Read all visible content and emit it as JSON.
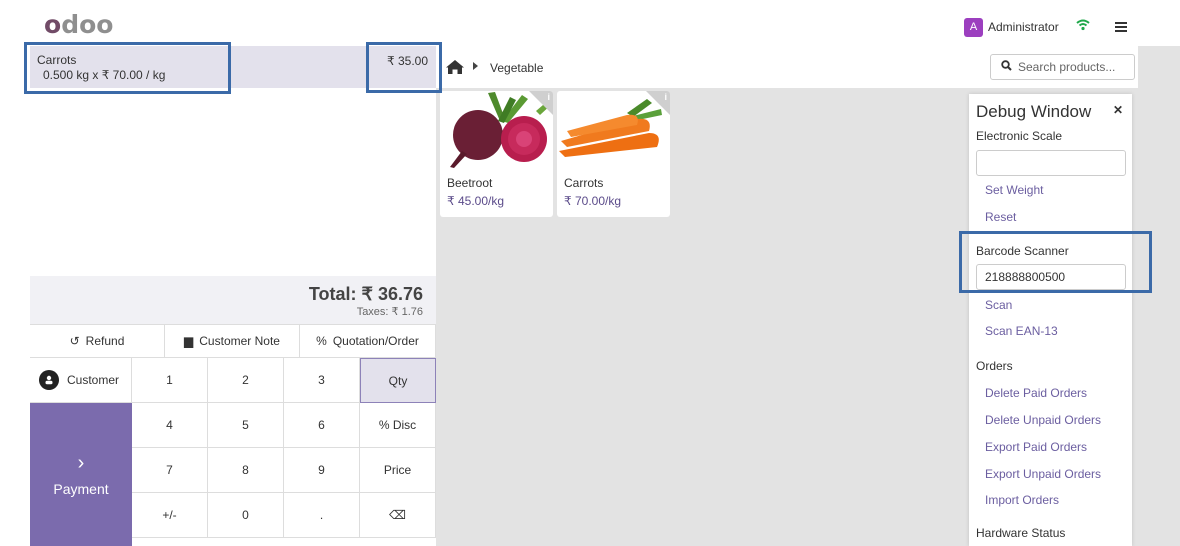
{
  "header": {
    "logo_o1": "o",
    "logo_d": "d",
    "logo_o2": "o",
    "logo_o3": "o",
    "user_initial": "A",
    "user_name": "Administrator"
  },
  "order": {
    "line": {
      "product": "Carrots",
      "detail": "0.500  kg x ₹ 70.00 / kg",
      "price": "₹ 35.00"
    },
    "total": "Total: ₹ 36.76",
    "taxes": "Taxes: ₹ 1.76"
  },
  "controls": {
    "refund": "Refund",
    "customer_note": "Customer Note",
    "quotation": "Quotation/Order"
  },
  "numpad": {
    "customer": "Customer",
    "payment": "Payment",
    "keys": [
      "1",
      "2",
      "3",
      "Qty",
      "4",
      "5",
      "6",
      "% Disc",
      "7",
      "8",
      "9",
      "Price",
      "+/-",
      "0",
      ".",
      "⌫"
    ]
  },
  "catalog": {
    "breadcrumb": "Vegetable",
    "search_placeholder": "Search products...",
    "products": [
      {
        "name": "Beetroot",
        "price": "₹ 45.00/kg"
      },
      {
        "name": "Carrots",
        "price": "₹ 70.00/kg"
      }
    ]
  },
  "debug": {
    "title": "Debug Window",
    "scale_section": "Electronic Scale",
    "set_weight": "Set Weight",
    "reset": "Reset",
    "barcode_section": "Barcode Scanner",
    "barcode_value": "218888800500",
    "scan": "Scan",
    "scan_ean": "Scan EAN-13",
    "orders_section": "Orders",
    "delete_paid": "Delete Paid Orders",
    "delete_unpaid": "Delete Unpaid Orders",
    "export_paid": "Export Paid Orders",
    "export_unpaid": "Export Unpaid Orders",
    "import_orders": "Import Orders",
    "hardware_section": "Hardware Status"
  },
  "colors": {
    "brand": "#714B67",
    "accent": "#7b6bad",
    "link": "#6b5ea0",
    "highlight_box": "#3b6aa8"
  }
}
